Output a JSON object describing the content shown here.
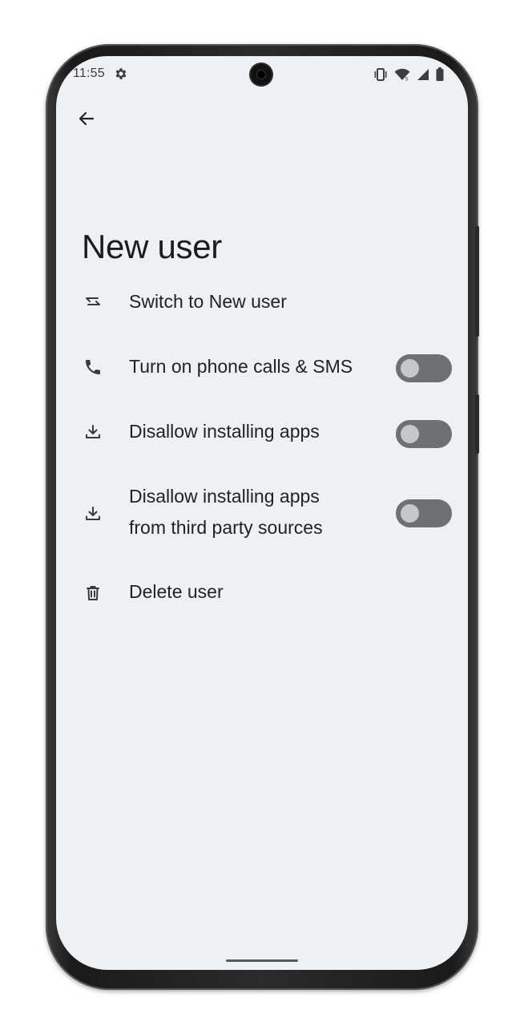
{
  "status_bar": {
    "time": "11:55",
    "icons": [
      "settings-icon",
      "vibrate-icon",
      "wifi-icon",
      "signal-icon",
      "battery-icon"
    ]
  },
  "app_bar": {
    "back_icon": "arrow-back-icon"
  },
  "title": "New user",
  "items": [
    {
      "icon": "swap-icon",
      "label": "Switch to New user",
      "has_toggle": false
    },
    {
      "icon": "phone-icon",
      "label": "Turn on phone calls & SMS",
      "has_toggle": true,
      "toggle_on": false
    },
    {
      "icon": "download-icon",
      "label": "Disallow installing apps",
      "has_toggle": true,
      "toggle_on": false
    },
    {
      "icon": "download-icon",
      "label_line1": "Disallow installing apps",
      "label_line2": "from third party sources",
      "has_toggle": true,
      "toggle_on": false
    },
    {
      "icon": "trash-icon",
      "label": "Delete user",
      "has_toggle": false
    }
  ],
  "colors": {
    "screen_background": "#eff0f3",
    "toggle_track_off": "#6e7072",
    "toggle_knob_off": "#c6c7c9",
    "text_primary": "#222222"
  }
}
